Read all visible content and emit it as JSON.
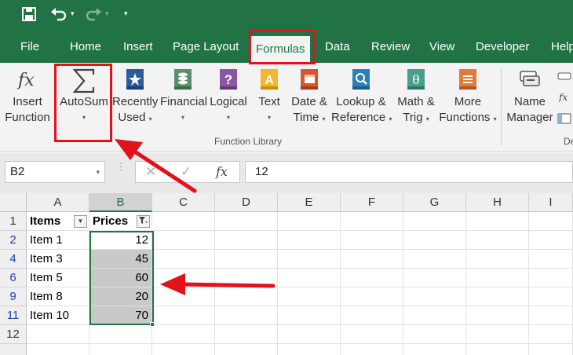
{
  "qat": {
    "save_icon": "save-icon",
    "undo_icon": "undo-icon",
    "redo_icon": "redo-icon",
    "customize_icon": "customize-caret-icon"
  },
  "tabs": [
    {
      "label": "File"
    },
    {
      "label": "Home"
    },
    {
      "label": "Insert"
    },
    {
      "label": "Page Layout"
    },
    {
      "label": "Formulas",
      "active": true
    },
    {
      "label": "Data"
    },
    {
      "label": "Review"
    },
    {
      "label": "View"
    },
    {
      "label": "Developer"
    },
    {
      "label": "Help"
    }
  ],
  "ribbon": {
    "buttons": [
      {
        "line1": "Insert",
        "line2": "Function",
        "icon": "fx-icon"
      },
      {
        "line1": "AutoSum",
        "line2": "",
        "icon": "sigma-icon",
        "dropdown": true
      },
      {
        "line1": "Recently",
        "line2": "Used",
        "icon": "star-book-icon",
        "dropdown": true
      },
      {
        "line1": "Financial",
        "line2": "",
        "icon": "coins-book-icon",
        "dropdown": true
      },
      {
        "line1": "Logical",
        "line2": "",
        "icon": "question-book-icon",
        "dropdown": true
      },
      {
        "line1": "Text",
        "line2": "",
        "icon": "text-book-icon",
        "dropdown": true
      },
      {
        "line1": "Date &",
        "line2": "Time",
        "icon": "calendar-book-icon",
        "dropdown": true
      },
      {
        "line1": "Lookup &",
        "line2": "Reference",
        "icon": "magnifier-book-icon",
        "dropdown": true
      },
      {
        "line1": "Math &",
        "line2": "Trig",
        "icon": "theta-book-icon",
        "dropdown": true
      },
      {
        "line1": "More",
        "line2": "Functions",
        "icon": "more-book-icon",
        "dropdown": true
      },
      {
        "line1": "Name",
        "line2": "Manager",
        "icon": "name-tags-icon"
      }
    ],
    "group_label": "Function Library",
    "next_group_label_partial": "De"
  },
  "formula_bar": {
    "name_box": "B2",
    "cancel_icon": "cancel-x-icon",
    "enter_icon": "enter-check-icon",
    "fx_label": "fx",
    "value": "12"
  },
  "columns": [
    "A",
    "B",
    "C",
    "D",
    "E",
    "F",
    "G",
    "H",
    "I"
  ],
  "selected_column": "B",
  "rows": [
    {
      "num": "1",
      "a": "Items",
      "b": "Prices",
      "header": true
    },
    {
      "num": "2",
      "a": "Item 1",
      "b": "12"
    },
    {
      "num": "4",
      "a": "Item 3",
      "b": "45"
    },
    {
      "num": "6",
      "a": "Item 5",
      "b": "60"
    },
    {
      "num": "9",
      "a": "Item 8",
      "b": "20"
    },
    {
      "num": "11",
      "a": "Item 10",
      "b": "70"
    },
    {
      "num": "12",
      "a": "",
      "b": ""
    }
  ],
  "colors": {
    "excel_green": "#217346",
    "annotation_red": "#e4111b",
    "filtered_row_blue": "#1f3fbf",
    "selection_shade": "#c9c9c9"
  }
}
